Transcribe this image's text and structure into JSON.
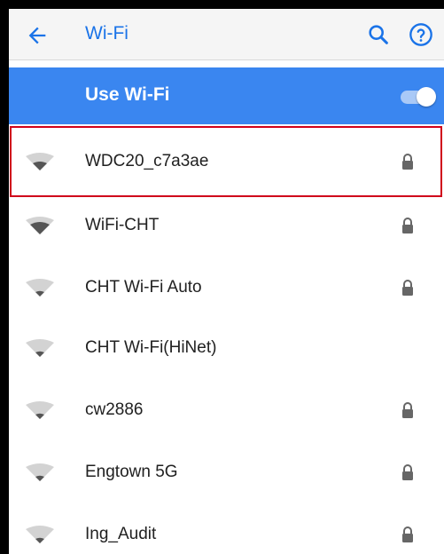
{
  "app_bar": {
    "title": "Wi-Fi",
    "back_icon": "arrow-left-icon",
    "search_icon": "search-icon",
    "help_icon": "help-circle-icon"
  },
  "toggle": {
    "label": "Use Wi-Fi",
    "state": "on"
  },
  "networks": [
    {
      "name": "WDC20_c7a3ae",
      "secured": true,
      "selected": true
    },
    {
      "name": "WiFi-CHT",
      "secured": true
    },
    {
      "name": "CHT Wi-Fi Auto",
      "secured": true
    },
    {
      "name": "CHT Wi-Fi(HiNet)",
      "secured": false
    },
    {
      "name": "cw2886",
      "secured": true
    },
    {
      "name": "Engtown 5G",
      "secured": true
    },
    {
      "name": "Ing_Audit",
      "secured": true
    }
  ],
  "colors": {
    "accent": "#1a73e8",
    "toggle_row": "#3a86f0",
    "selection_outline": "#d0021b"
  }
}
